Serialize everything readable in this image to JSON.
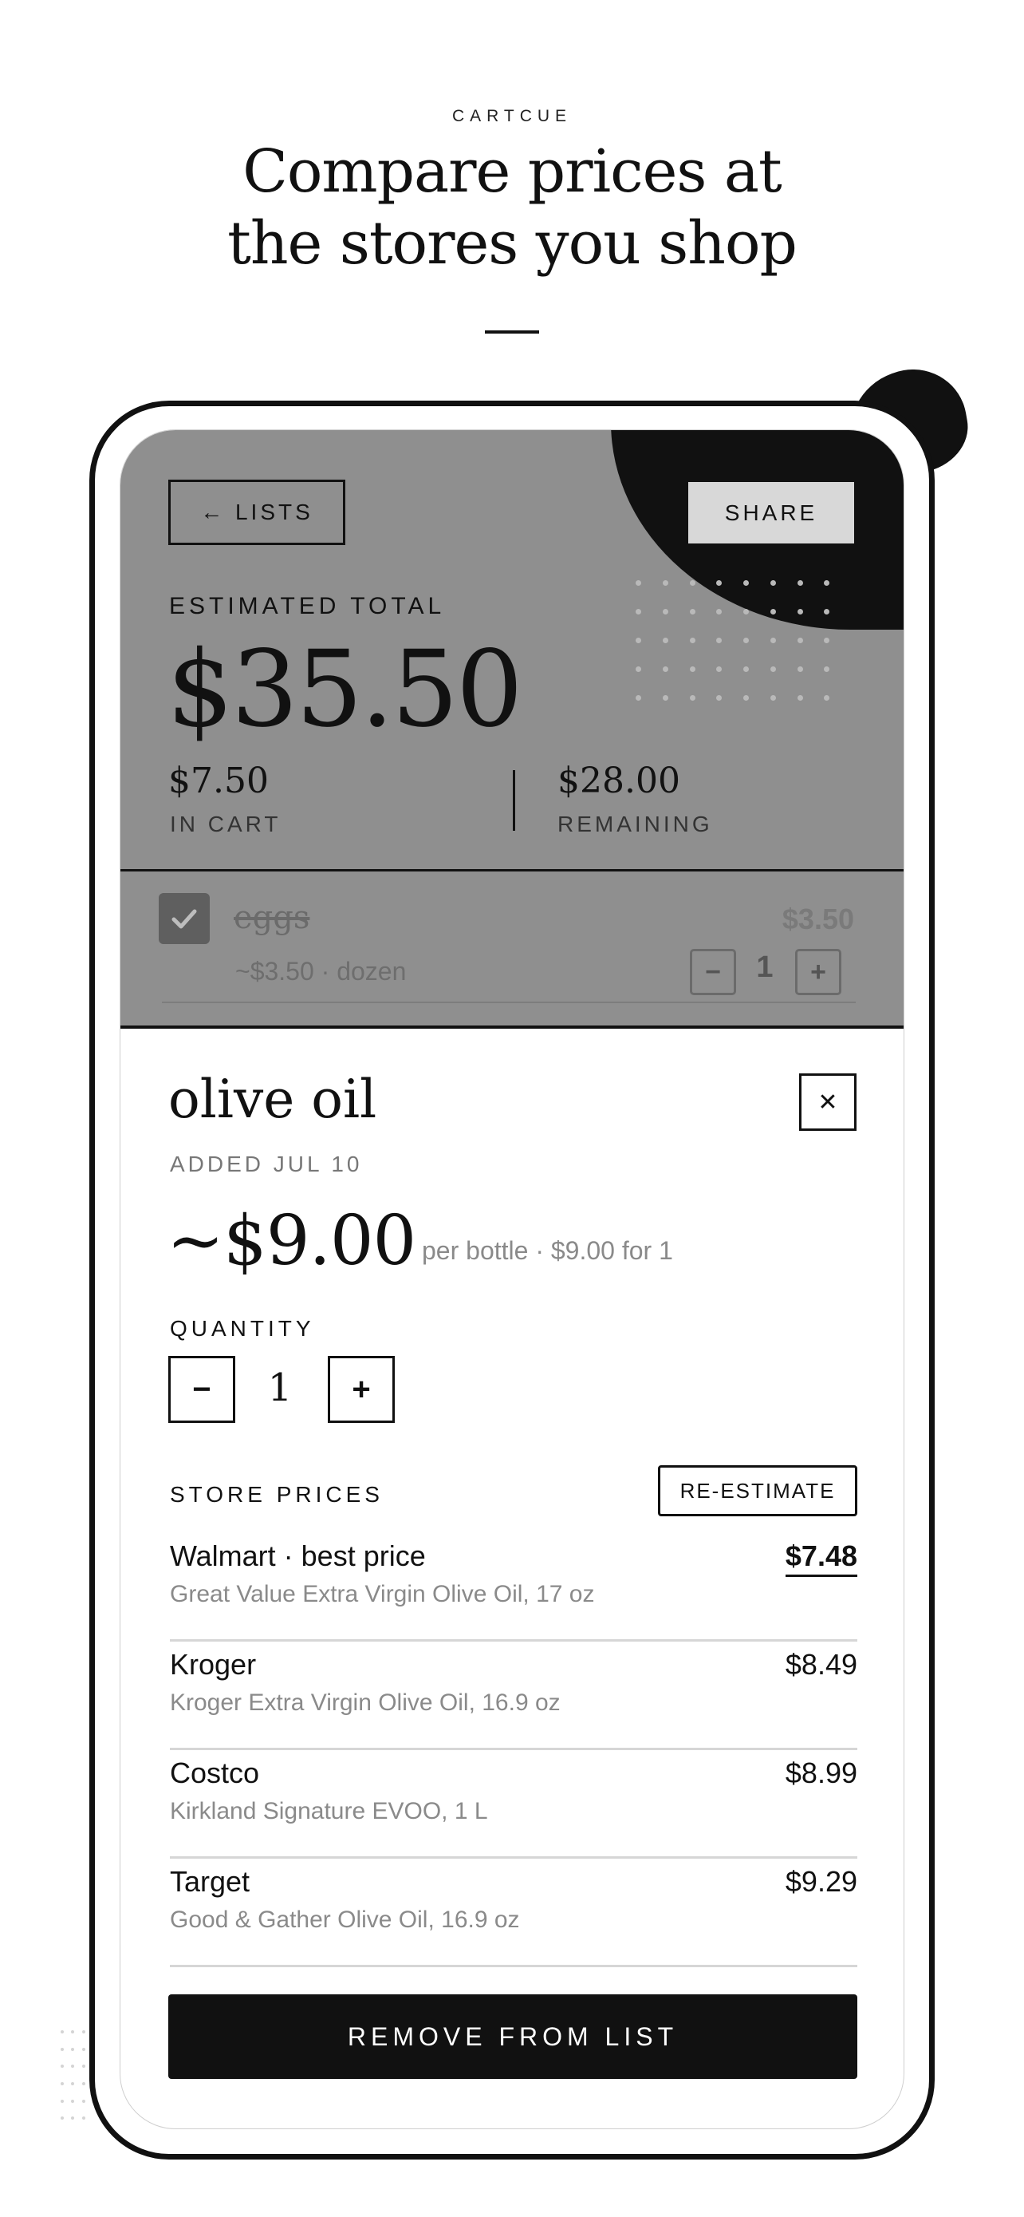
{
  "brand": "CARTCUE",
  "headline": {
    "line1": "Compare prices at",
    "line2": "the stores you shop"
  },
  "header": {
    "back_label": "← LISTS",
    "share_label": "SHARE",
    "estimated_label": "ESTIMATED TOTAL",
    "estimated_total": "$35.50",
    "in_cart_amount": "$7.50",
    "in_cart_label": "IN CART",
    "remaining_amount": "$28.00",
    "remaining_label": "REMAINING"
  },
  "cart_item": {
    "name": "eggs",
    "price": "$3.50",
    "meta": "~$3.50 · dozen",
    "quantity": "1",
    "checked": true
  },
  "detail": {
    "title": "olive oil",
    "added": "ADDED JUL 10",
    "price": "~$9.00",
    "price_note": "per bottle · $9.00 for 1",
    "quantity_label": "QUANTITY",
    "quantity": "1",
    "store_prices_label": "STORE PRICES",
    "reestimate_label": "RE-ESTIMATE",
    "stores": [
      {
        "name": "Walmart · best price",
        "product": "Great Value Extra Virgin Olive Oil, 17 oz",
        "price": "$7.48",
        "best": true
      },
      {
        "name": "Kroger",
        "product": "Kroger Extra Virgin Olive Oil, 16.9 oz",
        "price": "$8.49"
      },
      {
        "name": "Costco",
        "product": "Kirkland Signature EVOO, 1 L",
        "price": "$8.99"
      },
      {
        "name": "Target",
        "product": "Good & Gather Olive Oil, 16.9 oz",
        "price": "$9.29"
      }
    ],
    "remove_label": "REMOVE FROM LIST"
  },
  "colors": {
    "ink": "#111111",
    "header_bg": "#8f8f8f",
    "muted": "#8a8a8a"
  },
  "icons": {
    "check": "checkmark-icon",
    "close": "close-icon",
    "minus": "minus-icon",
    "plus": "plus-icon"
  }
}
